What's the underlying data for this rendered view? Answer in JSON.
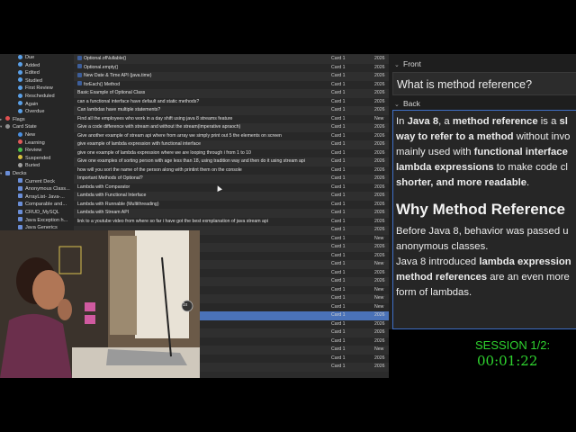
{
  "sidebar": {
    "items": [
      {
        "label": "Due",
        "kind": "dot",
        "color": "#5aa0e8",
        "caret": ""
      },
      {
        "label": "Added",
        "kind": "dot",
        "color": "#5aa0e8",
        "caret": ""
      },
      {
        "label": "Edited",
        "kind": "dot",
        "color": "#5aa0e8",
        "caret": ""
      },
      {
        "label": "Studied",
        "kind": "dot",
        "color": "#5aa0e8",
        "caret": ""
      },
      {
        "label": "First Review",
        "kind": "dot",
        "color": "#5aa0e8",
        "caret": ""
      },
      {
        "label": "Rescheduled",
        "kind": "dot",
        "color": "#5aa0e8",
        "caret": ""
      },
      {
        "label": "Again",
        "kind": "dot",
        "color": "#5aa0e8",
        "caret": ""
      },
      {
        "label": "Overdue",
        "kind": "dot",
        "color": "#5aa0e8",
        "caret": ""
      },
      {
        "label": "Flags",
        "kind": "dot",
        "color": "#e05050",
        "caret": "▸"
      },
      {
        "label": "Card State",
        "kind": "dot",
        "color": "#8f8f8f",
        "caret": "▾"
      },
      {
        "label": "New",
        "kind": "dot",
        "color": "#4a8fe0",
        "caret": ""
      },
      {
        "label": "Learning",
        "kind": "dot",
        "color": "#e05a5a",
        "caret": ""
      },
      {
        "label": "Review",
        "kind": "dot",
        "color": "#4cbf4c",
        "caret": ""
      },
      {
        "label": "Suspended",
        "kind": "dot",
        "color": "#d8c040",
        "caret": ""
      },
      {
        "label": "Buried",
        "kind": "dot",
        "color": "#a0a0a0",
        "caret": ""
      },
      {
        "label": "Decks",
        "kind": "sq",
        "color": "#6a8ed8",
        "caret": "▾"
      },
      {
        "label": "Current Deck",
        "kind": "sq",
        "color": "#6a8ed8",
        "caret": ""
      },
      {
        "label": "Anonymous Class...",
        "kind": "sq",
        "color": "#6a8ed8",
        "caret": ""
      },
      {
        "label": "ArrayList- Java-...",
        "kind": "sq",
        "color": "#6a8ed8",
        "caret": ""
      },
      {
        "label": "Comparable and...",
        "kind": "sq",
        "color": "#6a8ed8",
        "caret": ""
      },
      {
        "label": "CRUD_MySQL",
        "kind": "sq",
        "color": "#6a8ed8",
        "caret": ""
      },
      {
        "label": "Java Exception h...",
        "kind": "sq",
        "color": "#6a8ed8",
        "caret": ""
      },
      {
        "label": "Java Generics",
        "kind": "sq",
        "color": "#6a8ed8",
        "caret": ""
      }
    ]
  },
  "list": {
    "rows": [
      {
        "sort": "Optional.ofNullable()",
        "card": "Card 1",
        "due": "2026",
        "icon": true
      },
      {
        "sort": "Optional.empty()",
        "card": "Card 1",
        "due": "2026",
        "icon": true
      },
      {
        "sort": "New Date & Time API (java.time)",
        "card": "Card 1",
        "due": "2026",
        "icon": true
      },
      {
        "sort": "forEach() Method",
        "card": "Card 1",
        "due": "2026",
        "icon": true
      },
      {
        "sort": "Basic Example of Optional Class",
        "card": "Card 1",
        "due": "2026",
        "icon": false
      },
      {
        "sort": "can a functional interface have default and static methods?",
        "card": "Card 1",
        "due": "2026",
        "icon": false
      },
      {
        "sort": "Can lambdas have multiple statements?",
        "card": "Card 1",
        "due": "2026",
        "icon": false
      },
      {
        "sort": "Find all the employees who work in a day shift using java 8 streams feature",
        "card": "Card 1",
        "due": "New",
        "icon": false
      },
      {
        "sort": "Give a code difference with stream and without the stream(imperative apraoch)",
        "card": "Card 1",
        "due": "2026",
        "icon": false
      },
      {
        "sort": "Give another example of stream api where from array we simply print out 5 the elements on screen",
        "card": "Card 1",
        "due": "2026",
        "icon": false
      },
      {
        "sort": "give example of lambda expression with functional interface",
        "card": "Card 1",
        "due": "2026",
        "icon": false
      },
      {
        "sort": "give one example of lambda expression where we are looping through i from 1 to 10",
        "card": "Card 1",
        "due": "2026",
        "icon": false
      },
      {
        "sort": "Give one examples of sorting person with age less than 18, using tradition way and then do it using stream api",
        "card": "Card 1",
        "due": "2026",
        "icon": false
      },
      {
        "sort": "how will you sort the name of the person along with printint them on the console",
        "card": "Card 1",
        "due": "2026",
        "icon": false
      },
      {
        "sort": "Important Methods of Optional?",
        "card": "Card 1",
        "due": "2026",
        "icon": false
      },
      {
        "sort": "Lambda with Comparator",
        "card": "Card 1",
        "due": "2026",
        "icon": false
      },
      {
        "sort": "Lambda with Functional Interface",
        "card": "Card 1",
        "due": "2026",
        "icon": false
      },
      {
        "sort": "Lambda with Runnable (Multithreading)",
        "card": "Card 1",
        "due": "2026",
        "icon": false
      },
      {
        "sort": "Lambda with Stream API",
        "card": "Card 1",
        "due": "2026",
        "icon": false
      },
      {
        "sort": "link to a youtube video from where so far i have got the best exmplanation of java stream api",
        "card": "Card 1",
        "due": "2026",
        "icon": false
      },
      {
        "sort": "",
        "card": "Card 1",
        "due": "2026",
        "icon": false
      },
      {
        "sort": "",
        "card": "Card 1",
        "due": "New",
        "icon": false
      },
      {
        "sort": "",
        "card": "Card 1",
        "due": "2026",
        "icon": false
      },
      {
        "sort": "",
        "card": "Card 1",
        "due": "2026",
        "icon": false
      },
      {
        "sort": "e",
        "card": "Card 1",
        "due": "New",
        "icon": false
      },
      {
        "sort": "person list to a console",
        "card": "Card 1",
        "due": "2026",
        "icon": false
      },
      {
        "sort": "",
        "card": "Card 1",
        "due": "2026",
        "icon": false
      },
      {
        "sort": "",
        "card": "Card 1",
        "due": "New",
        "icon": false
      },
      {
        "sort": "",
        "card": "Card 1",
        "due": "New",
        "icon": false
      },
      {
        "sort": "",
        "card": "Card 1",
        "due": "New",
        "icon": false
      },
      {
        "sort": "",
        "card": "Card 1",
        "due": "2026",
        "icon": false,
        "selected": true
      },
      {
        "sort": "",
        "card": "Card 1",
        "due": "2026",
        "icon": false
      },
      {
        "sort": "",
        "card": "Card 1",
        "due": "2026",
        "icon": false
      },
      {
        "sort": "",
        "card": "Card 1",
        "due": "2026",
        "icon": false
      },
      {
        "sort": "runnable inteface",
        "card": "Card 1",
        "due": "New",
        "icon": false
      },
      {
        "sort": "",
        "card": "Card 1",
        "due": "2026",
        "icon": false
      },
      {
        "sort": "",
        "card": "Card 1",
        "due": "2026",
        "icon": false
      }
    ]
  },
  "editor": {
    "front_label": "Front",
    "front_value": "What is method reference?",
    "back_label": "Back",
    "back": {
      "p1_a": "In ",
      "p1_java8": "Java 8",
      "p1_b": ", a ",
      "p1_mr": "method reference",
      "p1_c": " is a ",
      "p1_sl": "sl",
      "p1_way": "way to refer to a method",
      "p1_d": " without invo",
      "p1_e": "mainly used with ",
      "p1_fi": "functional interface",
      "p1_le": "lambda expressions",
      "p1_f": " to make code cl",
      "p1_g": "shorter, and more readable",
      "p1_h": ".",
      "heading": "Why Method Reference",
      "p2_a": "Before Java 8, behavior was passed u",
      "p2_b": "anonymous classes.",
      "p3_a": "Java 8 introduced ",
      "p3_le": "lambda expression",
      "p3_mr": "method references",
      "p3_b": " are an even more",
      "p3_c": "form of lambdas."
    }
  },
  "session": {
    "label": "SESSION 1/2:",
    "timer": "00:01:22"
  },
  "webcam": {
    "badge": "1x"
  },
  "colors": {
    "accent": "#3f6fc7",
    "selection": "#4a72b8",
    "session_green": "#2fd42f"
  }
}
